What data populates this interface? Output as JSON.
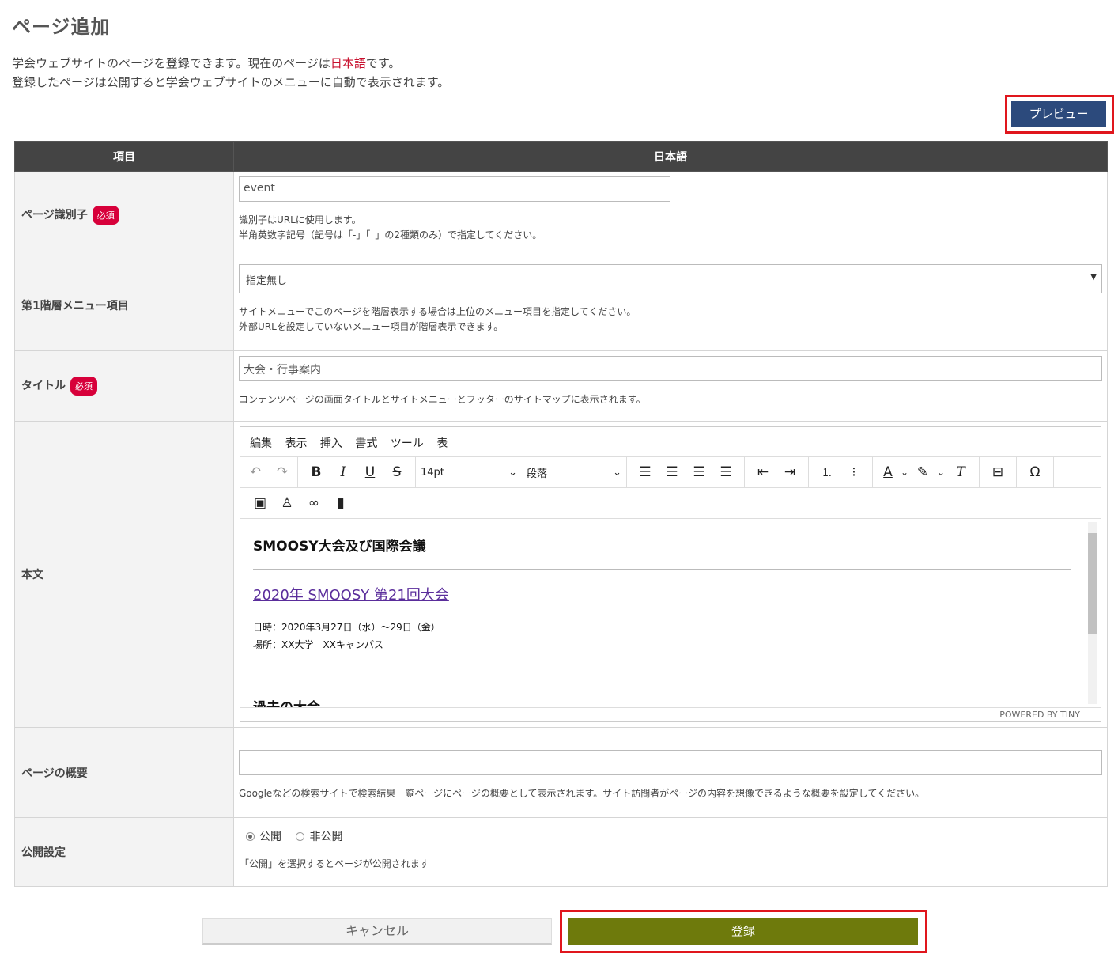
{
  "page": {
    "title": "ページ追加",
    "intro_line1_a": "学会ウェブサイトのページを登録できます。現在のページは",
    "intro_line1_lang": "日本語",
    "intro_line1_b": "です。",
    "intro_line2": "登録したページは公開すると学会ウェブサイトのメニューに自動で表示されます。"
  },
  "preview_button": "プレビュー",
  "table": {
    "col_item": "項目",
    "col_lang": "日本語"
  },
  "required_badge": "必須",
  "fields": {
    "identifier": {
      "label": "ページ識別子",
      "value": "event",
      "help1": "識別子はURLに使用します。",
      "help2": "半角英数字記号（記号は「-」「_」の2種類のみ）で指定してください。"
    },
    "menu": {
      "label": "第1階層メニュー項目",
      "selected": "指定無し",
      "help1": "サイトメニューでこのページを階層表示する場合は上位のメニュー項目を指定してください。",
      "help2": "外部URLを設定していないメニュー項目が階層表示できます。"
    },
    "title": {
      "label": "タイトル",
      "value": "大会・行事案内",
      "help": "コンテンツページの画面タイトルとサイトメニューとフッターのサイトマップに表示されます。"
    },
    "body": {
      "label": "本文"
    },
    "summary": {
      "label": "ページの概要",
      "value": "",
      "help": "Googleなどの検索サイトで検索結果一覧ページにページの概要として表示されます。サイト訪問者がページの内容を想像できるような概要を設定してください。"
    },
    "publish": {
      "label": "公開設定",
      "option_public": "公開",
      "option_private": "非公開",
      "selected": "公開",
      "help": "「公開」を選択するとページが公開されます"
    }
  },
  "editor": {
    "menu": [
      "編集",
      "表示",
      "挿入",
      "書式",
      "ツール",
      "表"
    ],
    "font_size": "14pt",
    "block_format": "段落",
    "content": {
      "heading": "SMOOSY大会及び国際会議",
      "link": "2020年 SMOOSY 第21回大会",
      "line1": "日時：2020年3月27日（水）～29日（金）",
      "line2": "場所：XX大学　XXキャンパス",
      "heading2": "過去の大会"
    },
    "powered_by": "POWERED BY TINY"
  },
  "buttons": {
    "cancel": "キャンセル",
    "submit": "登録"
  },
  "colors": {
    "preview_button": "#2c4a7c",
    "submit_button": "#6e7a0c",
    "required_badge": "#d7003a",
    "highlight_frame": "#e0161d"
  }
}
